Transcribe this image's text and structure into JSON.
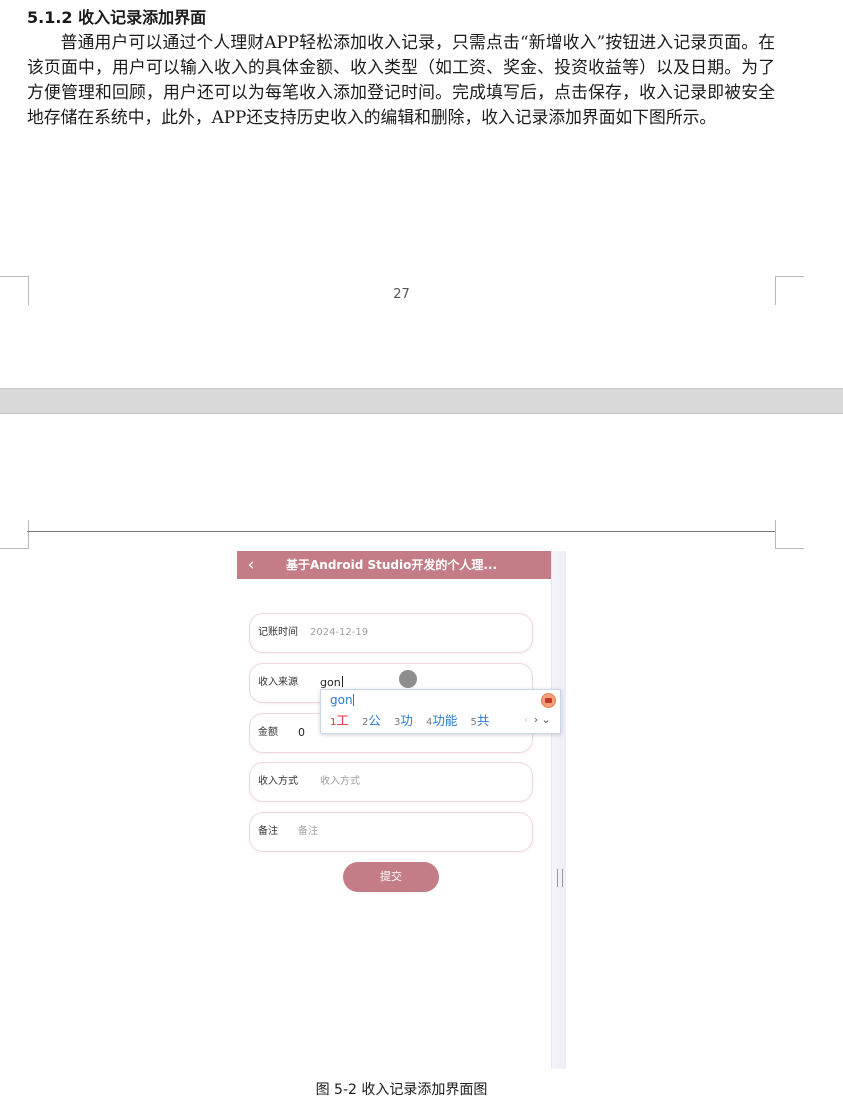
{
  "document": {
    "section_heading": "5.1.2 收入记录添加界面",
    "paragraph": "普通用户可以通过个人理财APP轻松添加收入记录，只需点击“新增收入”按钮进入记录页面。在该页面中，用户可以输入收入的具体金额、收入类型（如工资、奖金、投资收益等）以及日期。为了方便管理和回顾，用户还可以为每笔收入添加登记时间。完成填写后，点击保存，收入记录即被安全地存储在系统中，此外，APP还支持历史收入的编辑和删除，收入记录添加界面如下图所示。",
    "page_number": "27",
    "figure_caption": "图 5-2 收入记录添加界面图"
  },
  "app": {
    "title": "基于Android Studio开发的个人理...",
    "back_icon": "chevron-left-icon",
    "accent_color": "#c47d87",
    "fields": [
      {
        "label": "记账时间",
        "value": "2024-12-19",
        "state": "placeholder"
      },
      {
        "label": "收入来源",
        "value": "gon",
        "state": "filled"
      },
      {
        "label": "金额",
        "value": "0",
        "state": "filled"
      },
      {
        "label": "收入方式",
        "value": "收入方式",
        "state": "placeholder"
      },
      {
        "label": "备注",
        "value": "备注",
        "state": "placeholder"
      }
    ],
    "submit_label": "提交"
  },
  "ime": {
    "composition": "gon",
    "candidates": [
      {
        "num": "1",
        "text": "工"
      },
      {
        "num": "2",
        "text": "公"
      },
      {
        "num": "3",
        "text": "功"
      },
      {
        "num": "4",
        "text": "功能"
      },
      {
        "num": "5",
        "text": "共"
      }
    ],
    "nav": [
      "‹",
      "›",
      "⌄"
    ]
  }
}
